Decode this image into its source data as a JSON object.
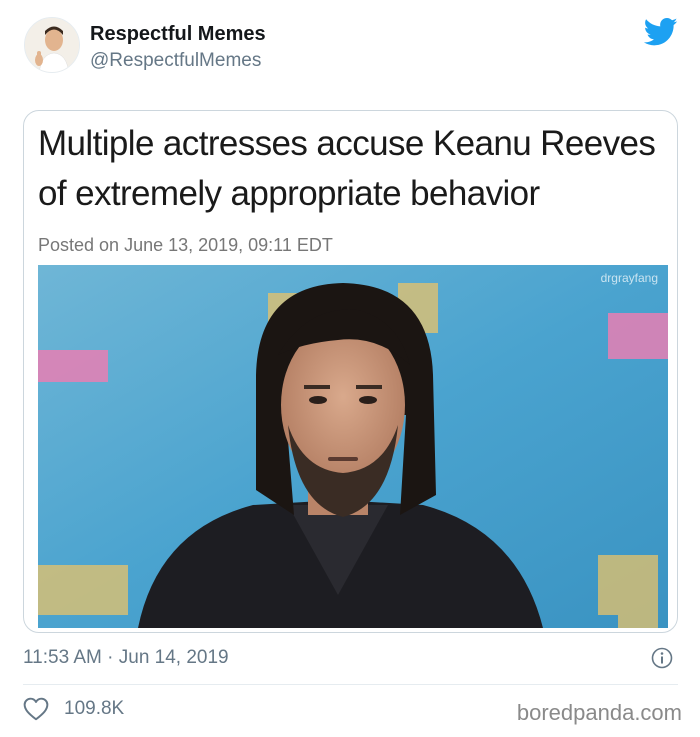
{
  "author": {
    "name": "Respectful Memes",
    "handle": "@RespectfulMemes"
  },
  "icons": {
    "brand": "twitter-bird-icon",
    "info": "info-icon",
    "like": "heart-icon"
  },
  "colors": {
    "twitter_blue": "#1da1f2",
    "secondary_text": "#657786"
  },
  "card": {
    "headline": "Multiple actresses accuse Keanu Reeves of extremely appropriate behavior",
    "posted": "Posted on June 13, 2019, 09:11 EDT",
    "watermark": "drgrayfang"
  },
  "footer": {
    "timestamp": "11:53 AM · Jun 14, 2019",
    "likes": "109.8K",
    "source": "boredpanda.com"
  }
}
